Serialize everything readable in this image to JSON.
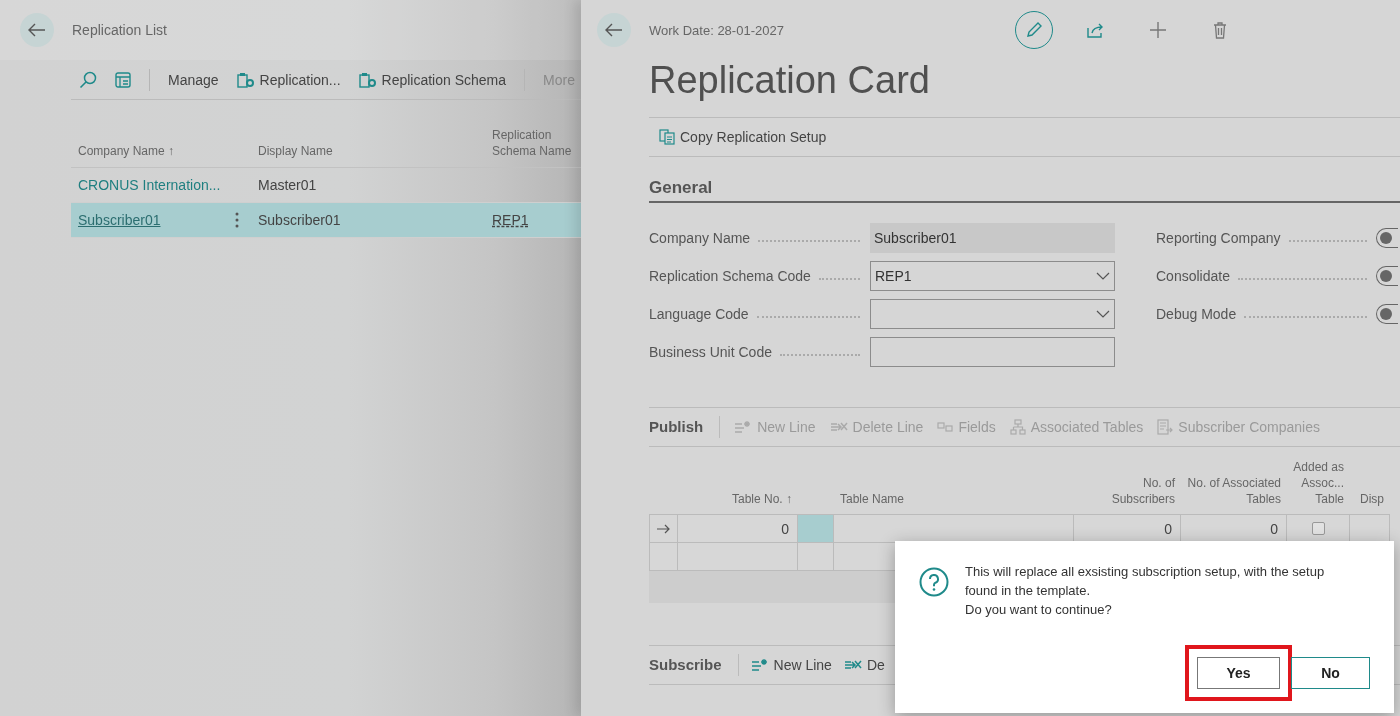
{
  "list_page": {
    "title": "Replication List",
    "actions": [
      {
        "label": "Manage",
        "kind": "plain"
      },
      {
        "label": "Replication...",
        "kind": "schema"
      },
      {
        "label": "Replication Schema",
        "kind": "schema"
      },
      {
        "label": "More",
        "kind": "more"
      }
    ],
    "columns": [
      "Company Name ↑",
      "Display Name",
      "Replication Schema Name"
    ],
    "rows": [
      {
        "company": "CRONUS Internation...",
        "display": "Master01",
        "selected": false
      },
      {
        "company": "Subscriber01",
        "display": "Subscriber01",
        "schema": "REP1",
        "selected": true
      }
    ]
  },
  "card_page": {
    "work_date": "Work Date: 28-01-2027",
    "title": "Replication Card",
    "actions": [
      {
        "label": "Copy Replication Setup",
        "kind": "copy"
      }
    ],
    "section": "General",
    "fields": [
      {
        "label": "Company Name",
        "kind": "readonly",
        "value": "Subscriber01"
      },
      {
        "label": "Replication Schema Code",
        "kind": "dropdown",
        "value": "REP1"
      },
      {
        "label": "Language Code",
        "kind": "dropdown"
      },
      {
        "label": "Business Unit Code",
        "kind": "text"
      }
    ],
    "toggles": [
      {
        "label": "Reporting Company",
        "on": false
      },
      {
        "label": "Consolidate",
        "on": false
      },
      {
        "label": "Debug Mode",
        "on": false
      }
    ],
    "publish": {
      "title": "Publish",
      "actions": [
        {
          "label": "New Line",
          "kind": "new-line",
          "disabled": true
        },
        {
          "label": "Delete Line",
          "kind": "delete-line",
          "disabled": true
        },
        {
          "label": "Fields",
          "kind": "fields",
          "disabled": true
        },
        {
          "label": "Associated Tables",
          "kind": "hierarchy",
          "disabled": true
        },
        {
          "label": "Subscriber Companies",
          "kind": "companies",
          "disabled": true
        }
      ],
      "columns": [
        "Table No. ↑",
        "Table Name",
        "No. of Subscribers",
        "No. of Associated Tables",
        "Added as Assoc... Table",
        "Disp"
      ],
      "rows": [
        {
          "table_no": "0",
          "subscribers": "0",
          "associated": "0",
          "added": false
        }
      ]
    },
    "subscribe": {
      "title": "Subscribe",
      "actions": [
        {
          "label": "New Line",
          "kind": "new-line",
          "disabled": false
        },
        {
          "label": "De",
          "kind": "delete-line",
          "disabled": false
        }
      ]
    }
  },
  "dialog": {
    "message": "This will replace all exsisting subscription setup, with the setup found in the template.\nDo you want to continue?",
    "buttons": [
      {
        "label": "Yes",
        "highlighted": true
      },
      {
        "label": "No",
        "highlighted": false
      }
    ]
  }
}
